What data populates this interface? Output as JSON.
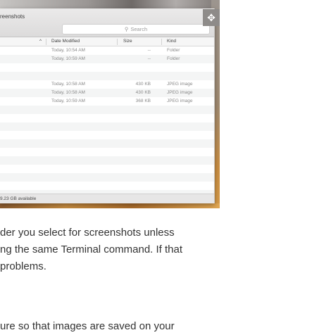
{
  "finder": {
    "window_title": "reenshots",
    "search_placeholder": "Search",
    "columns": {
      "sort_arrow": "^",
      "date_modified": "Date Modified",
      "size": "Size",
      "kind": "Kind"
    },
    "rows": [
      {
        "date": "Today, 10:54 AM",
        "size": "--",
        "kind": "Folder"
      },
      {
        "date": "Today, 10:59 AM",
        "size": "--",
        "kind": "Folder"
      },
      {
        "date": "",
        "size": "",
        "kind": ""
      },
      {
        "date": "",
        "size": "",
        "kind": ""
      },
      {
        "date": "Today, 10:58 AM",
        "size": "430 KB",
        "kind": "JPEG image"
      },
      {
        "date": "Today, 10:58 AM",
        "size": "430 KB",
        "kind": "JPEG image"
      },
      {
        "date": "Today, 10:59 AM",
        "size": "368 KB",
        "kind": "JPEG image"
      },
      {
        "date": "",
        "size": "",
        "kind": ""
      },
      {
        "date": "",
        "size": "",
        "kind": ""
      },
      {
        "date": "",
        "size": "",
        "kind": ""
      },
      {
        "date": "",
        "size": "",
        "kind": ""
      },
      {
        "date": "",
        "size": "",
        "kind": ""
      },
      {
        "date": "",
        "size": "",
        "kind": ""
      },
      {
        "date": "",
        "size": "",
        "kind": ""
      },
      {
        "date": "",
        "size": "",
        "kind": ""
      },
      {
        "date": "",
        "size": "",
        "kind": ""
      },
      {
        "date": "",
        "size": "",
        "kind": ""
      },
      {
        "date": "",
        "size": "",
        "kind": ""
      }
    ],
    "status_text": "9.23 GB available",
    "expand_icon": "move-arrows-icon"
  },
  "article": {
    "line1": "der you select for screenshots unless",
    "line2": "ng the same Terminal command. If that",
    "line3": "problems.",
    "line4": "ure so that images are saved on your"
  },
  "colors": {
    "text": "#333333",
    "window_bg": "#ffffff",
    "row_alt": "#f4f5f5",
    "muted_text": "#8a8a8a"
  }
}
